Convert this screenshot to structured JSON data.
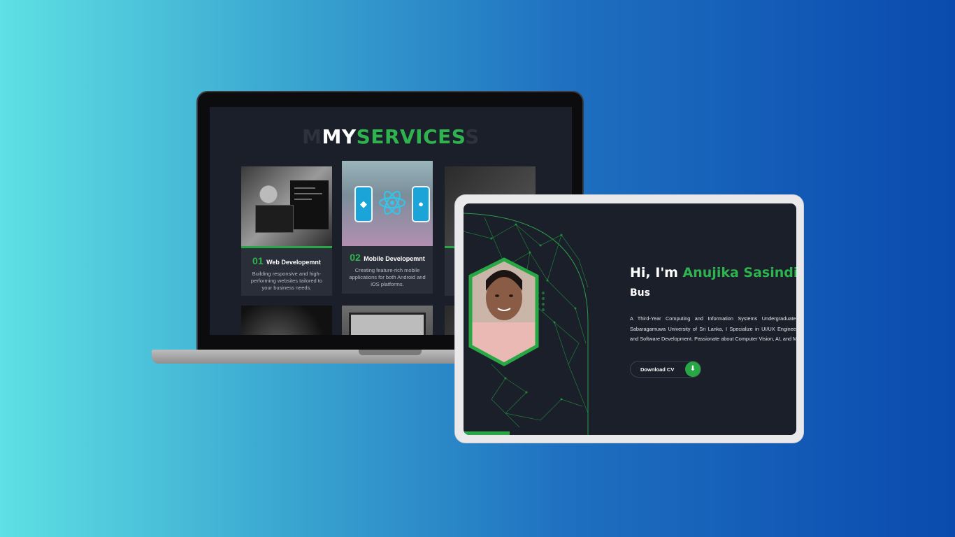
{
  "background": {
    "gradient": [
      "#5ee0e4",
      "#1e6fc0",
      "#0a4aae"
    ]
  },
  "laptop": {
    "title_prefix": "MY",
    "title_accent": "SERVICES",
    "title_ghost_left": "M",
    "title_ghost_right": "S",
    "cards": [
      {
        "number": "01",
        "title": "Web Developemnt",
        "desc": "Building responsive and high-performing websites tailored to your business needs."
      },
      {
        "number": "02",
        "title": "Mobile Developemnt",
        "desc": "Creating feature-rich mobile applications for both Android and iOS platforms."
      }
    ]
  },
  "tablet": {
    "greeting": "Hi, I'm ",
    "name": "Anujika Sasindi",
    "surname": "Bus",
    "description": "A Third-Year Computing and Information Systems Undergraduate at Sabaragamuwa University of Sri Lanka, I Specialize in UI/UX Engineering and Software Development. Passionate about Computer Vision, AI, and ML.",
    "cv_button": "Download CV",
    "cv_icon": "download-icon"
  },
  "colors": {
    "accent": "#2eb34f",
    "panel": "#1b1f2a"
  }
}
